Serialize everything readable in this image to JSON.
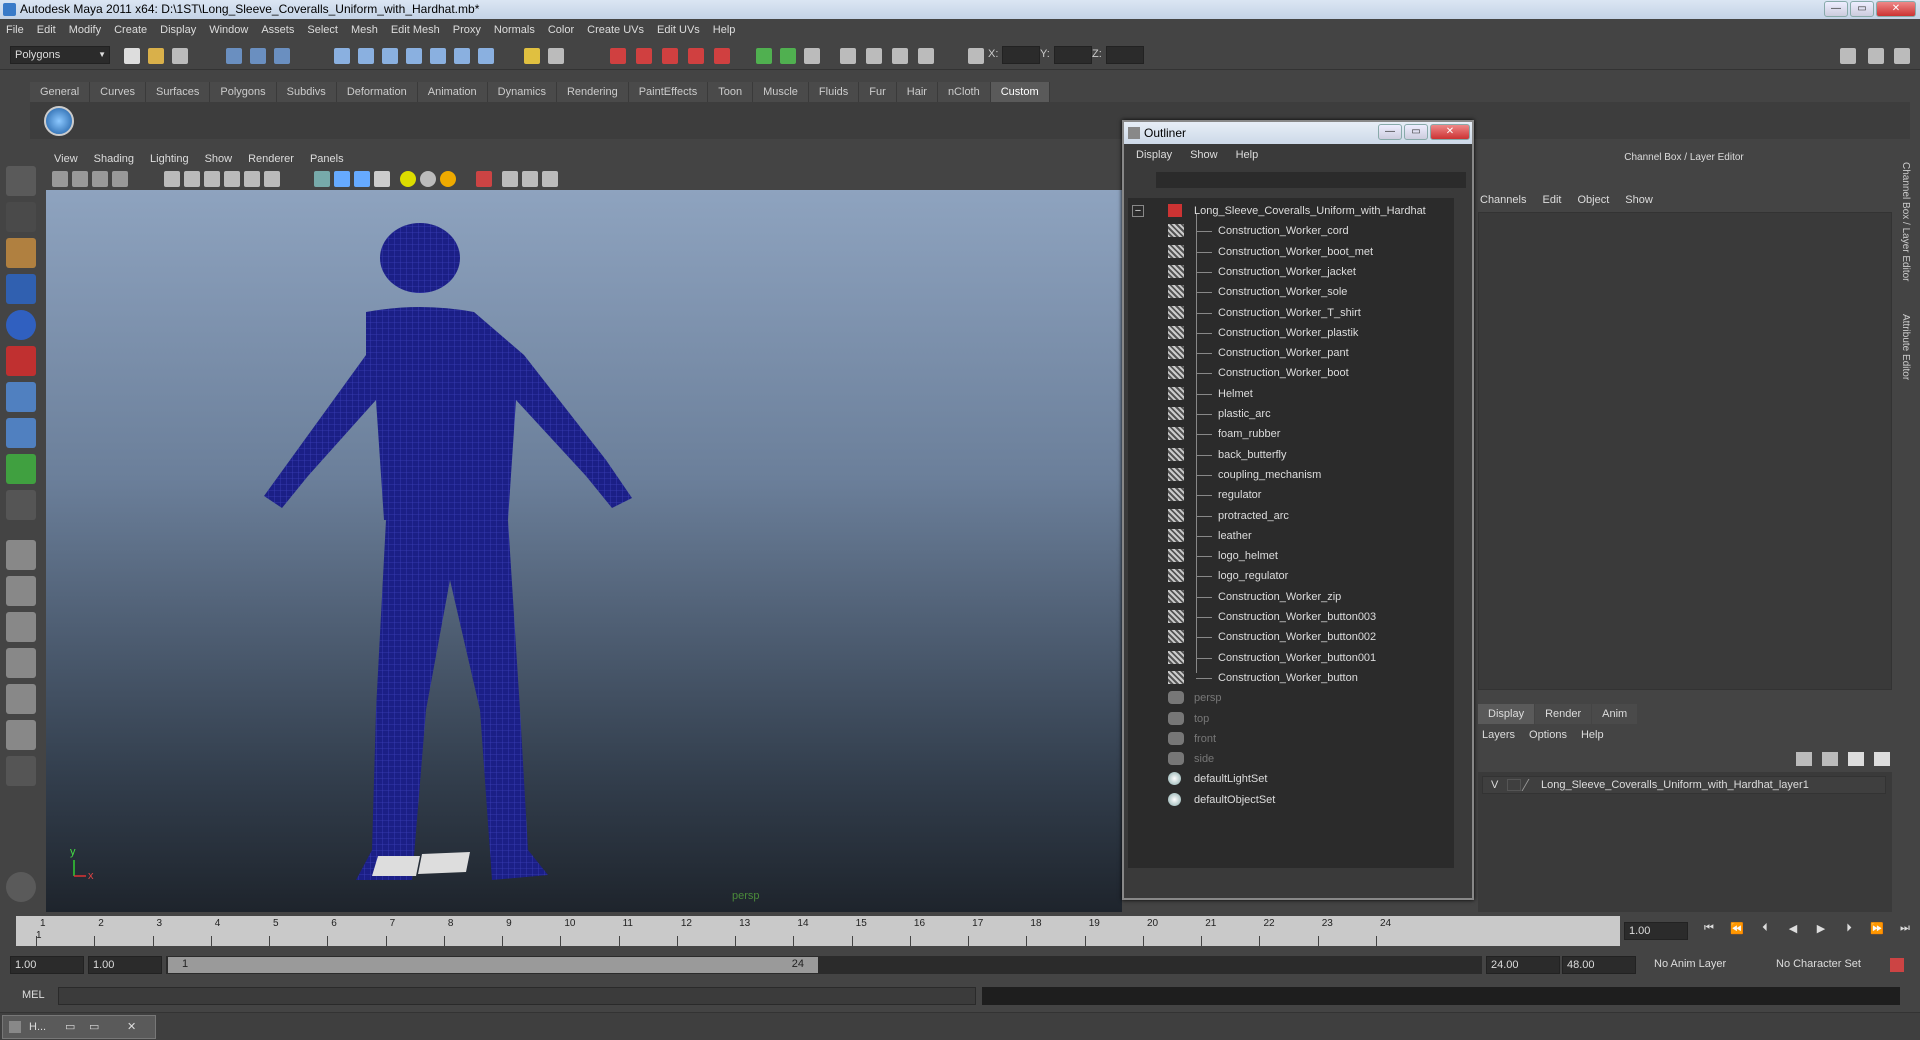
{
  "window": {
    "title": "Autodesk Maya 2011 x64: D:\\1ST\\Long_Sleeve_Coveralls_Uniform_with_Hardhat.mb*",
    "min": "—",
    "max": "▭",
    "close": "✕"
  },
  "menubar": [
    "File",
    "Edit",
    "Modify",
    "Create",
    "Display",
    "Window",
    "Assets",
    "Select",
    "Mesh",
    "Edit Mesh",
    "Proxy",
    "Normals",
    "Color",
    "Create UVs",
    "Edit UVs",
    "Help"
  ],
  "status": {
    "mode": "Polygons",
    "x_label": "X:",
    "y_label": "Y:",
    "z_label": "Z:"
  },
  "shelf_tabs": [
    "General",
    "Curves",
    "Surfaces",
    "Polygons",
    "Subdivs",
    "Deformation",
    "Animation",
    "Dynamics",
    "Rendering",
    "PaintEffects",
    "Toon",
    "Muscle",
    "Fluids",
    "Fur",
    "Hair",
    "nCloth",
    "Custom"
  ],
  "shelf_active": "Custom",
  "viewport": {
    "menu": [
      "View",
      "Shading",
      "Lighting",
      "Show",
      "Renderer",
      "Panels"
    ],
    "camera_label": "persp",
    "axis_y": "y",
    "axis_x": "x"
  },
  "outliner": {
    "title": "Outliner",
    "menu": [
      "Display",
      "Show",
      "Help"
    ],
    "collapse": "−",
    "root": "Long_Sleeve_Coveralls_Uniform_with_Hardhat",
    "children": [
      "Construction_Worker_cord",
      "Construction_Worker_boot_met",
      "Construction_Worker_jacket",
      "Construction_Worker_sole",
      "Construction_Worker_T_shirt",
      "Construction_Worker_plastik",
      "Construction_Worker_pant",
      "Construction_Worker_boot",
      "Helmet",
      "plastic_arc",
      "foam_rubber",
      "back_butterfly",
      "coupling_mechanism",
      "regulator",
      "protracted_arc",
      "leather",
      "logo_helmet",
      "logo_regulator",
      "Construction_Worker_zip",
      "Construction_Worker_button003",
      "Construction_Worker_button002",
      "Construction_Worker_button001",
      "Construction_Worker_button"
    ],
    "cameras": [
      "persp",
      "top",
      "front",
      "side"
    ],
    "sets": [
      "defaultLightSet",
      "defaultObjectSet"
    ]
  },
  "channel_box": {
    "title": "Channel Box / Layer Editor",
    "menu": [
      "Channels",
      "Edit",
      "Object",
      "Show"
    ]
  },
  "layer_editor": {
    "tabs": [
      "Display",
      "Render",
      "Anim"
    ],
    "active_tab": "Display",
    "menu": [
      "Layers",
      "Options",
      "Help"
    ],
    "layer_visibility": "V",
    "layer_name": "Long_Sleeve_Coveralls_Uniform_with_Hardhat_layer1"
  },
  "side_tabs": [
    "Channel Box / Layer Editor",
    "Attribute Editor"
  ],
  "timeline": {
    "ticks": [
      "1",
      "2",
      "3",
      "4",
      "5",
      "6",
      "7",
      "8",
      "9",
      "10",
      "11",
      "12",
      "13",
      "14",
      "15",
      "16",
      "17",
      "18",
      "19",
      "20",
      "21",
      "22",
      "23",
      "24"
    ],
    "current_marker": "1",
    "current_time": "1.00"
  },
  "range": {
    "start": "1.00",
    "playback_start": "1.00",
    "handle_start": "1",
    "handle_end": "24",
    "playback_end": "24.00",
    "end": "48.00",
    "anim_layer": "No Anim Layer",
    "char_set": "No Character Set"
  },
  "command": {
    "label": "MEL"
  },
  "taskbar": {
    "item": "H..."
  }
}
